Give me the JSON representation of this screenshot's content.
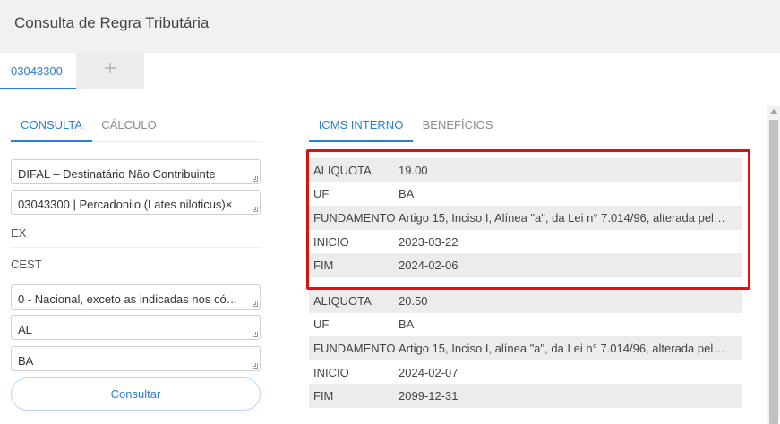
{
  "window": {
    "title": "Consulta de Regra Tributária"
  },
  "doc_tabs": {
    "active": "03043300",
    "add_symbol": "+"
  },
  "left_panel": {
    "tabs": [
      {
        "label": "CONSULTA",
        "active": true
      },
      {
        "label": "CÁLCULO",
        "active": false
      }
    ],
    "fields": {
      "operation": "DIFAL – Destinatário Não Contribuinte",
      "product": "03043300 | Percadonilo (Lates niloticus)×",
      "ex_label": "EX",
      "cest_label": "CEST",
      "origin": "0 - Nacional, exceto as indicadas nos có…",
      "uf_origin": "AL",
      "uf_dest": "BA"
    },
    "consult_button": "Consultar"
  },
  "right_panel": {
    "tabs": [
      {
        "label": "ICMS INTERNO",
        "active": true
      },
      {
        "label": "BENEFÍCIOS",
        "active": false
      }
    ],
    "records": [
      {
        "rows": [
          {
            "key": "ALIQUOTA",
            "value": "19.00"
          },
          {
            "key": "UF",
            "value": "BA"
          },
          {
            "key": "FUNDAMENTO",
            "value": "Artigo 15, Inciso I, Alínea \"a\", da Lei n° 7.014/96, alterada pel…"
          },
          {
            "key": "INICIO",
            "value": "2023-03-22"
          },
          {
            "key": "FIM",
            "value": "2024-02-06"
          }
        ]
      },
      {
        "rows": [
          {
            "key": "ALIQUOTA",
            "value": "20.50"
          },
          {
            "key": "UF",
            "value": "BA"
          },
          {
            "key": "FUNDAMENTO",
            "value": "Artigo 15, Inciso I, alínea \"a\", da Lei n° 7.014/96, alterada pel…"
          },
          {
            "key": "INICIO",
            "value": "2024-02-07"
          },
          {
            "key": "FIM",
            "value": "2099-12-31"
          }
        ]
      }
    ]
  },
  "colors": {
    "accent": "#2a7fd4",
    "highlight": "#e01010",
    "stripe": "#ececec"
  }
}
